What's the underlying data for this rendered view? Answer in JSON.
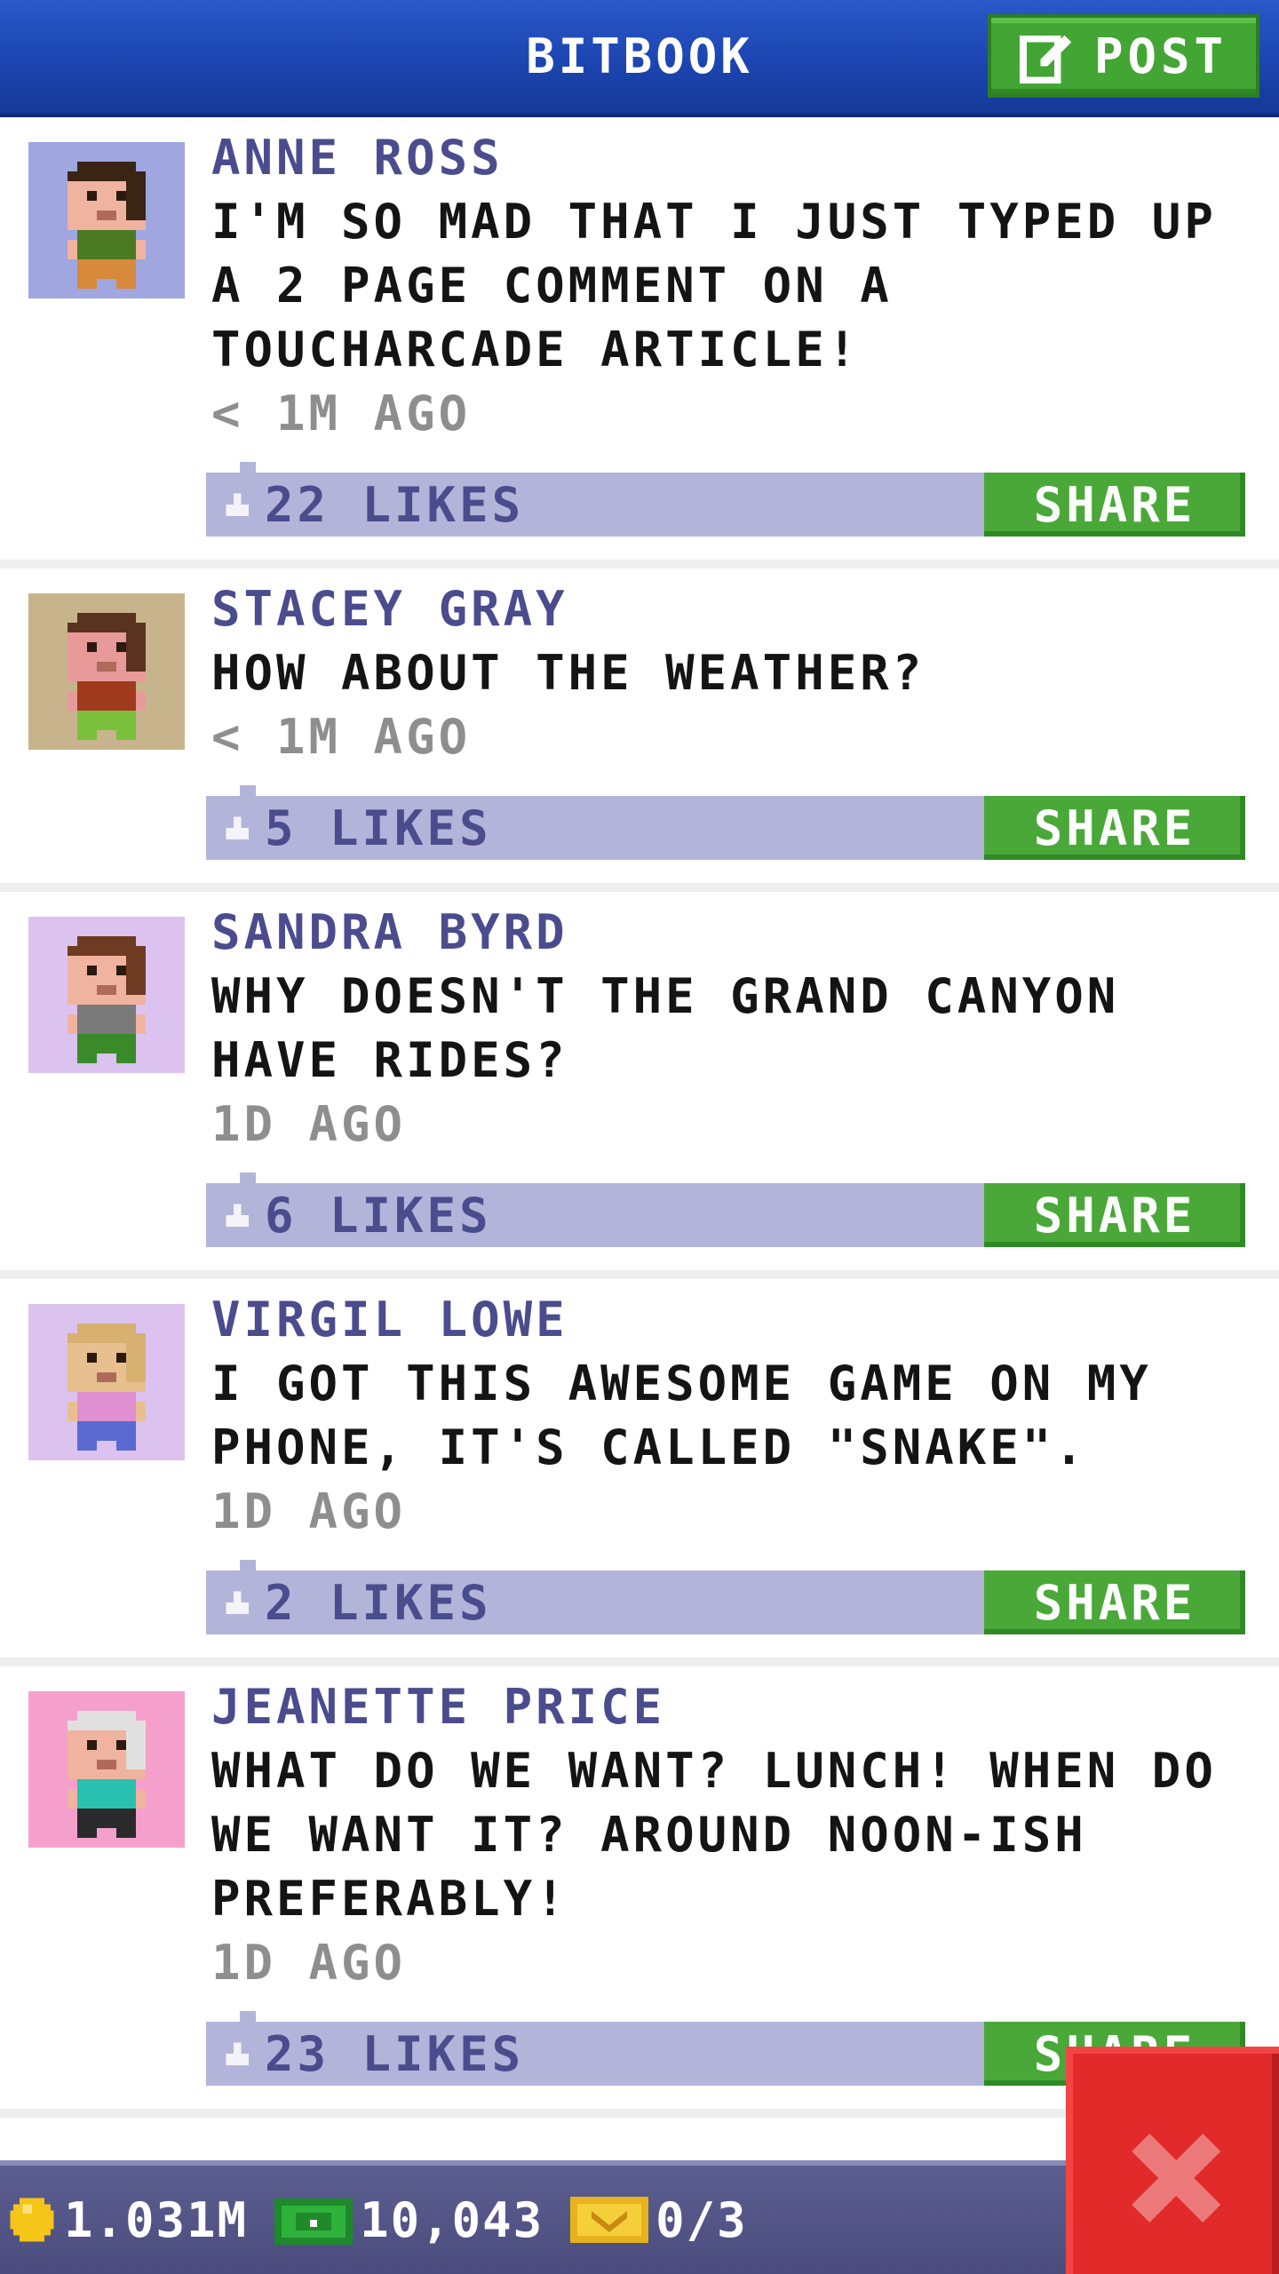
{
  "header": {
    "title": "BITBOOK",
    "post_label": "POST"
  },
  "posts": [
    {
      "author": "ANNE ROSS",
      "text": "I'M SO MAD THAT I JUST TYPED UP A 2 PAGE COMMENT ON A TOUCHARCADE ARTICLE!",
      "time": "< 1M AGO",
      "likes": "22 LIKES",
      "share": "SHARE",
      "avatar_bg": "#9fa6e0",
      "skin": "#f0b3a0",
      "hair": "#3a2414",
      "shirt": "#4a7a22",
      "pants": "#d68a3a"
    },
    {
      "author": "STACEY GRAY",
      "text": "HOW ABOUT THE WEATHER?",
      "time": "< 1M AGO",
      "likes": "5 LIKES",
      "share": "SHARE",
      "avatar_bg": "#c8b48c",
      "skin": "#e89a9a",
      "hair": "#5a3220",
      "shirt": "#a03a1c",
      "pants": "#7ac03a"
    },
    {
      "author": "SANDRA BYRD",
      "text": "WHY DOESN'T THE GRAND CANYON HAVE RIDES?",
      "time": "1D AGO",
      "likes": "6 LIKES",
      "share": "SHARE",
      "avatar_bg": "#dcc2ef",
      "skin": "#f0b3a0",
      "hair": "#6e3a22",
      "shirt": "#7a7a7a",
      "pants": "#3a8a2a"
    },
    {
      "author": "VIRGIL LOWE",
      "text": "I GOT THIS AWESOME GAME ON MY PHONE, IT'S CALLED \"SNAKE\".",
      "time": "1D AGO",
      "likes": "2 LIKES",
      "share": "SHARE",
      "avatar_bg": "#dcc2ef",
      "skin": "#e8c090",
      "hair": "#d8b070",
      "shirt": "#e090d0",
      "pants": "#5a6ad0"
    },
    {
      "author": "JEANETTE PRICE",
      "text": "WHAT DO WE WANT? LUNCH! WHEN DO WE WANT IT? AROUND NOON-ISH PREFERABLY!",
      "time": "1D AGO",
      "likes": "23 LIKES",
      "share": "SHARE",
      "avatar_bg": "#f5a0cc",
      "skin": "#f0b3a0",
      "hair": "#e0e0e0",
      "shirt": "#2ac0b0",
      "pants": "#2a2a2a"
    }
  ],
  "status": {
    "coins": "1.031M",
    "bux": "10,043",
    "tickets": "0/3"
  },
  "colors": {
    "header_blue": "#1c45b0",
    "green": "#4aa838",
    "like_bar": "#b3b4d9",
    "author": "#4b4c8e",
    "close_red": "#e22a2a"
  }
}
